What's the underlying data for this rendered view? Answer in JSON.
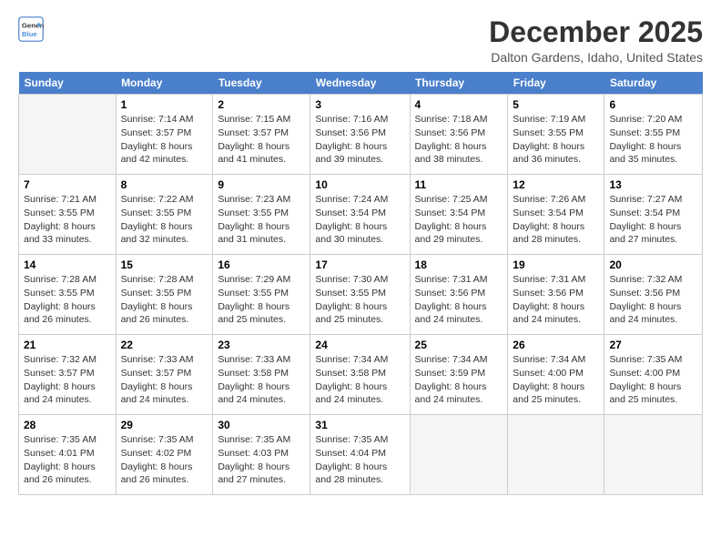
{
  "logo": {
    "line1": "General",
    "line2": "Blue"
  },
  "title": "December 2025",
  "location": "Dalton Gardens, Idaho, United States",
  "days_of_week": [
    "Sunday",
    "Monday",
    "Tuesday",
    "Wednesday",
    "Thursday",
    "Friday",
    "Saturday"
  ],
  "weeks": [
    [
      {
        "day": "",
        "empty": true
      },
      {
        "day": "1",
        "sunrise": "7:14 AM",
        "sunset": "3:57 PM",
        "daylight": "8 hours and 42 minutes."
      },
      {
        "day": "2",
        "sunrise": "7:15 AM",
        "sunset": "3:57 PM",
        "daylight": "8 hours and 41 minutes."
      },
      {
        "day": "3",
        "sunrise": "7:16 AM",
        "sunset": "3:56 PM",
        "daylight": "8 hours and 39 minutes."
      },
      {
        "day": "4",
        "sunrise": "7:18 AM",
        "sunset": "3:56 PM",
        "daylight": "8 hours and 38 minutes."
      },
      {
        "day": "5",
        "sunrise": "7:19 AM",
        "sunset": "3:55 PM",
        "daylight": "8 hours and 36 minutes."
      },
      {
        "day": "6",
        "sunrise": "7:20 AM",
        "sunset": "3:55 PM",
        "daylight": "8 hours and 35 minutes."
      }
    ],
    [
      {
        "day": "7",
        "sunrise": "7:21 AM",
        "sunset": "3:55 PM",
        "daylight": "8 hours and 33 minutes."
      },
      {
        "day": "8",
        "sunrise": "7:22 AM",
        "sunset": "3:55 PM",
        "daylight": "8 hours and 32 minutes."
      },
      {
        "day": "9",
        "sunrise": "7:23 AM",
        "sunset": "3:55 PM",
        "daylight": "8 hours and 31 minutes."
      },
      {
        "day": "10",
        "sunrise": "7:24 AM",
        "sunset": "3:54 PM",
        "daylight": "8 hours and 30 minutes."
      },
      {
        "day": "11",
        "sunrise": "7:25 AM",
        "sunset": "3:54 PM",
        "daylight": "8 hours and 29 minutes."
      },
      {
        "day": "12",
        "sunrise": "7:26 AM",
        "sunset": "3:54 PM",
        "daylight": "8 hours and 28 minutes."
      },
      {
        "day": "13",
        "sunrise": "7:27 AM",
        "sunset": "3:54 PM",
        "daylight": "8 hours and 27 minutes."
      }
    ],
    [
      {
        "day": "14",
        "sunrise": "7:28 AM",
        "sunset": "3:55 PM",
        "daylight": "8 hours and 26 minutes."
      },
      {
        "day": "15",
        "sunrise": "7:28 AM",
        "sunset": "3:55 PM",
        "daylight": "8 hours and 26 minutes."
      },
      {
        "day": "16",
        "sunrise": "7:29 AM",
        "sunset": "3:55 PM",
        "daylight": "8 hours and 25 minutes."
      },
      {
        "day": "17",
        "sunrise": "7:30 AM",
        "sunset": "3:55 PM",
        "daylight": "8 hours and 25 minutes."
      },
      {
        "day": "18",
        "sunrise": "7:31 AM",
        "sunset": "3:56 PM",
        "daylight": "8 hours and 24 minutes."
      },
      {
        "day": "19",
        "sunrise": "7:31 AM",
        "sunset": "3:56 PM",
        "daylight": "8 hours and 24 minutes."
      },
      {
        "day": "20",
        "sunrise": "7:32 AM",
        "sunset": "3:56 PM",
        "daylight": "8 hours and 24 minutes."
      }
    ],
    [
      {
        "day": "21",
        "sunrise": "7:32 AM",
        "sunset": "3:57 PM",
        "daylight": "8 hours and 24 minutes."
      },
      {
        "day": "22",
        "sunrise": "7:33 AM",
        "sunset": "3:57 PM",
        "daylight": "8 hours and 24 minutes."
      },
      {
        "day": "23",
        "sunrise": "7:33 AM",
        "sunset": "3:58 PM",
        "daylight": "8 hours and 24 minutes."
      },
      {
        "day": "24",
        "sunrise": "7:34 AM",
        "sunset": "3:58 PM",
        "daylight": "8 hours and 24 minutes."
      },
      {
        "day": "25",
        "sunrise": "7:34 AM",
        "sunset": "3:59 PM",
        "daylight": "8 hours and 24 minutes."
      },
      {
        "day": "26",
        "sunrise": "7:34 AM",
        "sunset": "4:00 PM",
        "daylight": "8 hours and 25 minutes."
      },
      {
        "day": "27",
        "sunrise": "7:35 AM",
        "sunset": "4:00 PM",
        "daylight": "8 hours and 25 minutes."
      }
    ],
    [
      {
        "day": "28",
        "sunrise": "7:35 AM",
        "sunset": "4:01 PM",
        "daylight": "8 hours and 26 minutes."
      },
      {
        "day": "29",
        "sunrise": "7:35 AM",
        "sunset": "4:02 PM",
        "daylight": "8 hours and 26 minutes."
      },
      {
        "day": "30",
        "sunrise": "7:35 AM",
        "sunset": "4:03 PM",
        "daylight": "8 hours and 27 minutes."
      },
      {
        "day": "31",
        "sunrise": "7:35 AM",
        "sunset": "4:04 PM",
        "daylight": "8 hours and 28 minutes."
      },
      {
        "day": "",
        "empty": true
      },
      {
        "day": "",
        "empty": true
      },
      {
        "day": "",
        "empty": true
      }
    ]
  ]
}
